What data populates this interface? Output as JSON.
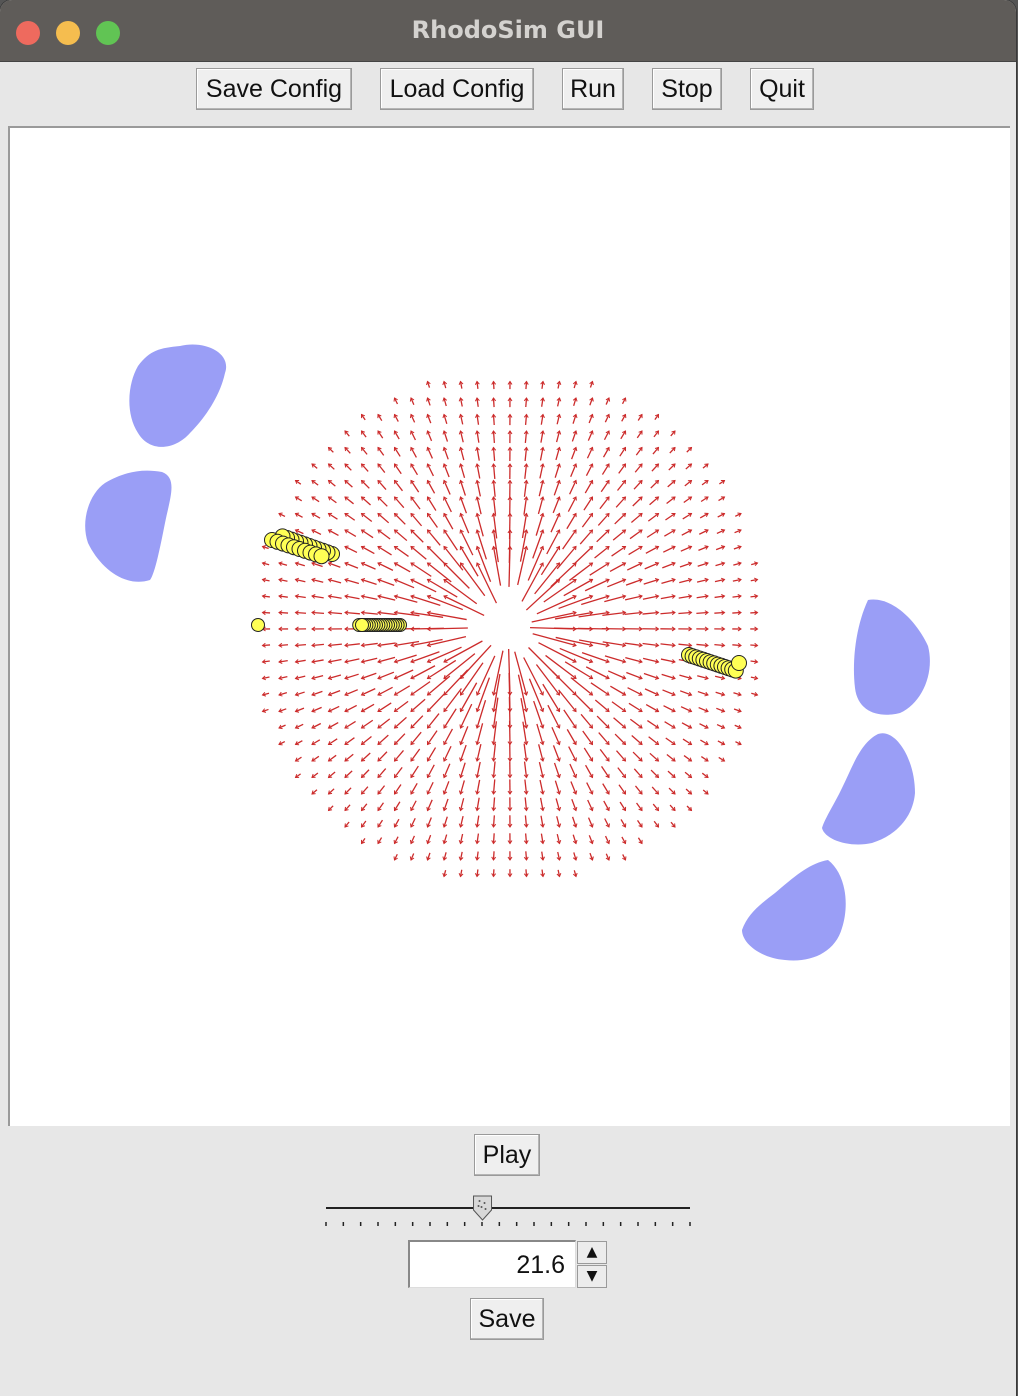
{
  "window": {
    "title": "RhodoSim GUI",
    "traffic_lights": {
      "close": "#ee6a5e",
      "minimize": "#f5bd4f",
      "zoom": "#61c454"
    }
  },
  "toolbar": {
    "save_config": "Save Config",
    "load_config": "Load Config",
    "run": "Run",
    "stop": "Stop",
    "quit": "Quit"
  },
  "canvas": {
    "background": "#ffffff",
    "colors": {
      "field_arrow": "#cc2b2b",
      "particle": "#ffff55",
      "particle_outline": "#222222",
      "blob": "#9a9ef6"
    }
  },
  "playback": {
    "play_label": "Play",
    "slider_value_fraction": 0.43,
    "spinbox_value": "21.6",
    "save_label": "Save"
  }
}
